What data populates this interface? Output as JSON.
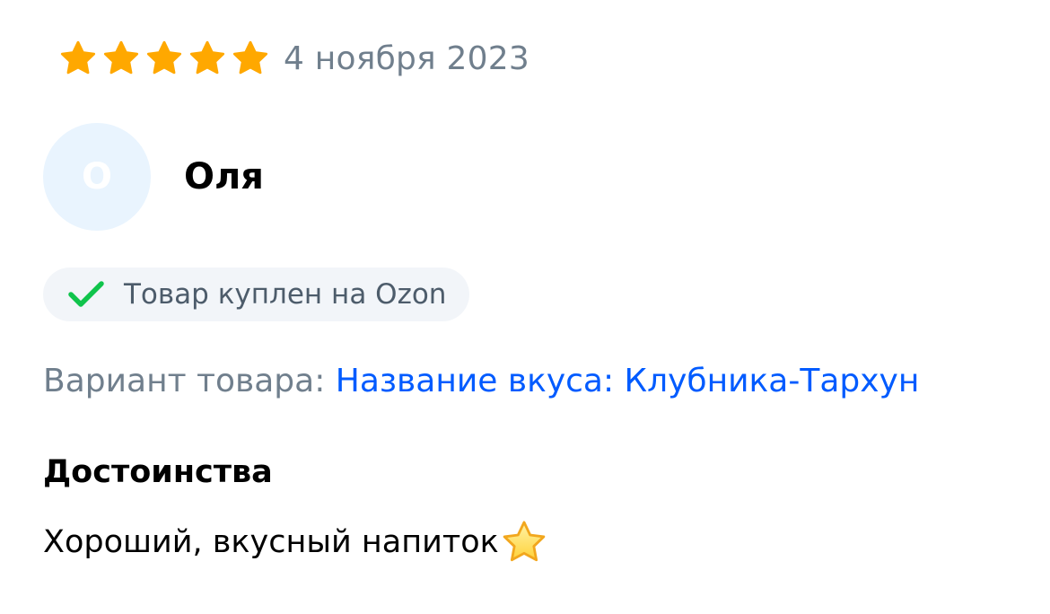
{
  "review": {
    "rating": 5,
    "rating_max": 5,
    "date": "4 ноября 2023",
    "star_color": "#ffa800",
    "author": {
      "initial": "О",
      "name": "Оля",
      "avatar_bg": "#e9f4fe"
    },
    "verified": {
      "icon": "check-icon",
      "text": "Товар куплен на Ozon",
      "icon_color": "#10c44c"
    },
    "variant": {
      "label": "Вариант товара: ",
      "value": "Название вкуса: Клубника-Тархун",
      "value_color": "#005bff"
    },
    "pros": {
      "title": "Достоинства",
      "text": "Хороший, вкусный напиток",
      "emoji": "star-emoji"
    }
  }
}
